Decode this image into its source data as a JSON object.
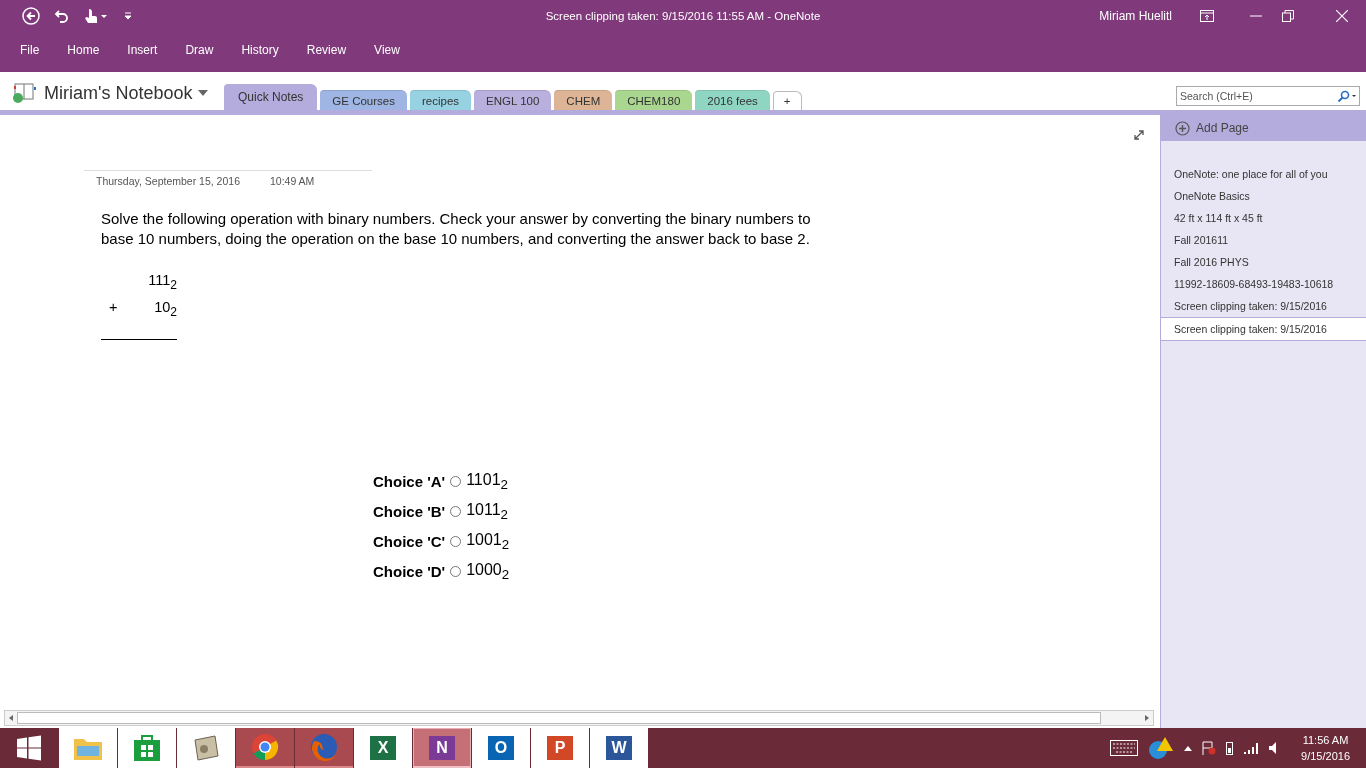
{
  "window": {
    "title": "Screen clipping taken: 9/15/2016 11:55 AM - OneNote",
    "user": "Miriam Huelitl"
  },
  "menu": [
    {
      "label": "File"
    },
    {
      "label": "Home"
    },
    {
      "label": "Insert"
    },
    {
      "label": "Draw"
    },
    {
      "label": "History"
    },
    {
      "label": "Review"
    },
    {
      "label": "View"
    }
  ],
  "notebook": {
    "name": "Miriam's Notebook"
  },
  "sections": [
    {
      "label": "Quick Notes",
      "color": "#b4acdc",
      "selected": true
    },
    {
      "label": "GE Courses",
      "color": "#9fb5e3",
      "selected": false
    },
    {
      "label": "recipes",
      "color": "#97d2e3",
      "selected": false
    },
    {
      "label": "ENGL 100",
      "color": "#b9b0de",
      "selected": false
    },
    {
      "label": "CHEM",
      "color": "#ddb596",
      "selected": false
    },
    {
      "label": "CHEM180",
      "color": "#a9d78f",
      "selected": false
    },
    {
      "label": "2016 fees",
      "color": "#8fd6c2",
      "selected": false
    }
  ],
  "new_section": {
    "label": "+"
  },
  "search": {
    "placeholder": "Search (Ctrl+E)"
  },
  "page": {
    "date": "Thursday, September 15, 2016",
    "time": "10:49 AM",
    "question": "Solve the following operation with binary numbers. Check your answer by converting the binary numbers to base 10 numbers, doing the operation on the base 10 numbers, and converting the answer back to base 2.",
    "operand_1": "111$_{2}$",
    "operator": "+",
    "operand_2": "10$_{2}$",
    "choices": [
      {
        "label": "Choice 'A'",
        "value": "1101$_{2}$",
        "selected": false
      },
      {
        "label": "Choice 'B'",
        "value": "1011$_{2}$",
        "selected": false
      },
      {
        "label": "Choice 'C'",
        "value": "1001$_{2}$",
        "selected": false
      },
      {
        "label": "Choice 'D'",
        "value": "1000$_{2}$",
        "selected": false
      }
    ]
  },
  "pages_pane": {
    "add_page": "Add Page",
    "pages": [
      {
        "title": "OneNote: one place for all of you",
        "selected": false
      },
      {
        "title": "OneNote Basics",
        "selected": false
      },
      {
        "title": "42 ft x 114 ft x 45 ft",
        "selected": false
      },
      {
        "title": "Fall 201611",
        "selected": false
      },
      {
        "title": "Fall 2016 PHYS",
        "selected": false
      },
      {
        "title": "11992-18609-68493-19483-10618",
        "selected": false
      },
      {
        "title": "Screen clipping taken: 9/15/2016",
        "selected": false
      },
      {
        "title": "Screen clipping taken: 9/15/2016",
        "selected": true
      }
    ]
  },
  "taskbar": {
    "apps": [
      {
        "kind": "explorer",
        "running": false,
        "selected": false
      },
      {
        "kind": "store",
        "running": false,
        "selected": false
      },
      {
        "kind": "scanner",
        "running": false,
        "selected": false
      },
      {
        "kind": "chrome",
        "running": true,
        "selected": false
      },
      {
        "kind": "firefox",
        "running": true,
        "selected": false
      },
      {
        "kind": "excel",
        "letter": "X",
        "running": false,
        "selected": false
      },
      {
        "kind": "onenote",
        "letter": "N",
        "running": true,
        "selected": true
      },
      {
        "kind": "outlook",
        "letter": "O",
        "running": false,
        "selected": false
      },
      {
        "kind": "powerpoint",
        "letter": "P",
        "running": false,
        "selected": false
      },
      {
        "kind": "word",
        "letter": "W",
        "running": false,
        "selected": false
      }
    ],
    "time": "11:56 AM",
    "date": "9/15/2016"
  }
}
